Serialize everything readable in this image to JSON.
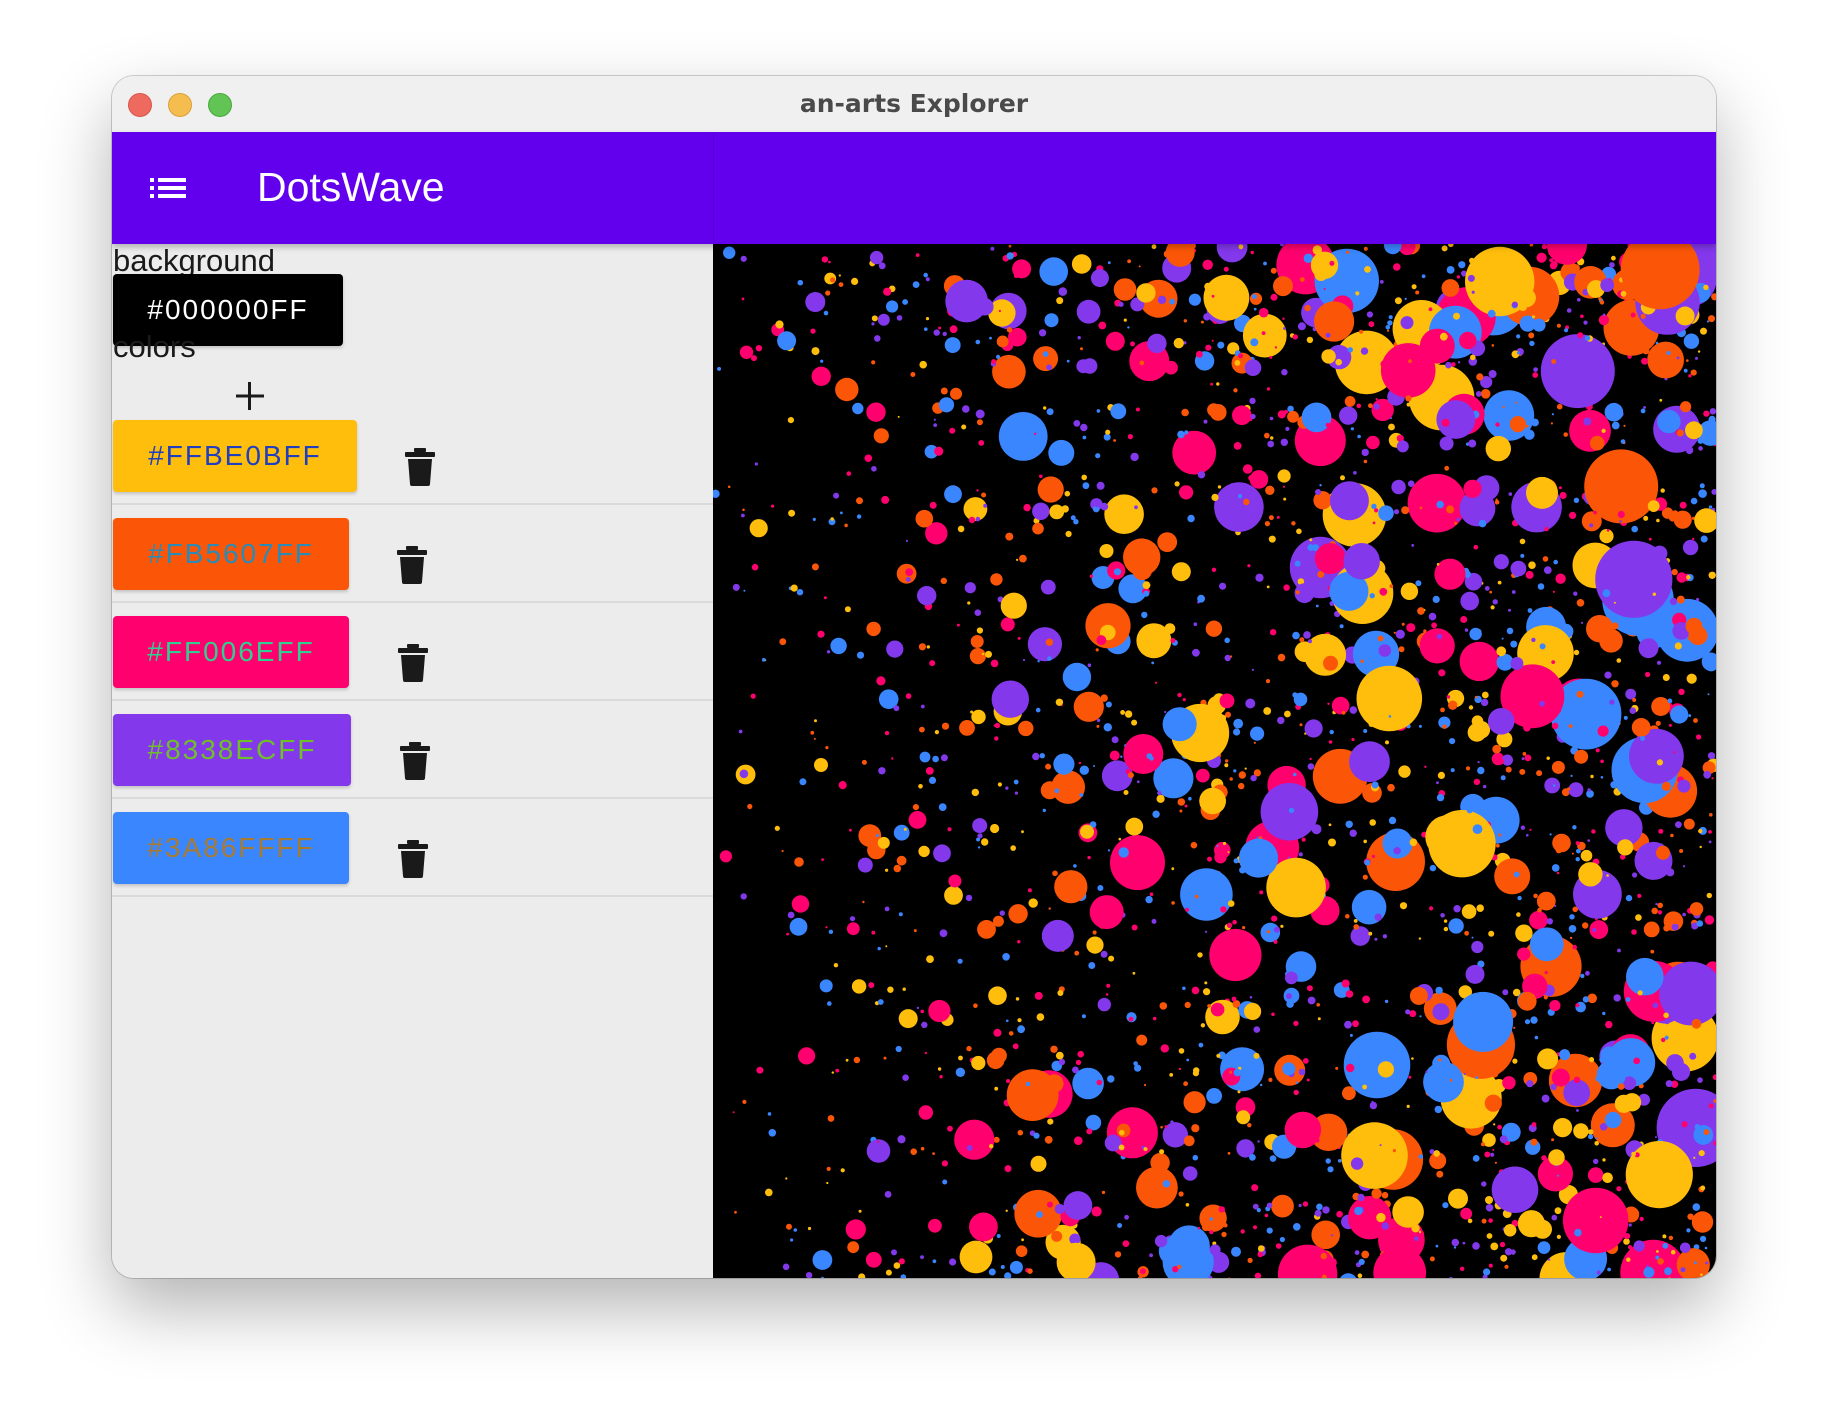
{
  "window": {
    "title": "an-arts Explorer"
  },
  "appbar": {
    "title": "DotsWave",
    "menu_icon": "list-icon"
  },
  "settings": {
    "background_label": "background",
    "background_value": "#000000FF",
    "background_color": "#000000",
    "background_text_color": "#ffffff",
    "colors_label": "colors",
    "add_icon": "plus-icon",
    "delete_icon": "trash-icon",
    "colors": [
      {
        "value": "#FFBE0BFF",
        "fill": "#FFBE0B",
        "text": "#1f3fbf"
      },
      {
        "value": "#FB5607FF",
        "fill": "#FB5607",
        "text": "#2a8bb6"
      },
      {
        "value": "#FF006EFF",
        "fill": "#FF006E",
        "text": "#2fd08f"
      },
      {
        "value": "#8338ECFF",
        "fill": "#8338EC",
        "text": "#6fbf2a"
      },
      {
        "value": "#3A86FFFF",
        "fill": "#3A86FF",
        "text": "#a87b33"
      }
    ]
  },
  "canvas": {
    "palette": [
      "#FFBE0B",
      "#FB5607",
      "#FF006E",
      "#8338EC",
      "#3A86FF"
    ]
  }
}
